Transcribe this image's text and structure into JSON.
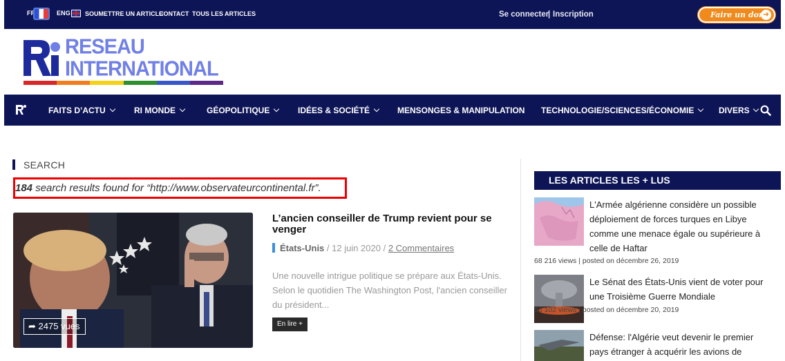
{
  "topbar": {
    "lang_fr": "FR",
    "lang_en": "ENG",
    "links": [
      "SOUMETTRE UN ARTICLE",
      "CONTACT",
      "TOUS LES ARTICLES"
    ],
    "login": "Se connecter",
    "separator": "|",
    "register": "Inscription",
    "donate": "Faire un don"
  },
  "logo": {
    "line1": "RESEAU",
    "line2": "INTERNATIONAL"
  },
  "nav": {
    "items": [
      "FAITS D’ACTU",
      "RI MONDE",
      "GÉOPOLITIQUE",
      "IDÉES & SOCIÉTÉ",
      "MENSONGES & MANIPULATION",
      "TECHNOLOGIE/SCIENCES/ÉCONOMIE",
      "DIVERS"
    ]
  },
  "search": {
    "label": "SEARCH",
    "count": "184",
    "results_text": " search results found for “http://www.observateurcontinental.fr”."
  },
  "article": {
    "views": "2475 vues",
    "title": "L’ancien conseiller de Trump revient pour se venger",
    "category": "États-Unis",
    "date": " / 12 juin 2020 / ",
    "comments": "2 Commentaires",
    "excerpt": "Une nouvelle intrigue politique se prépare aux États-Unis. Selon le quotidien The Washington Post, l'ancien conseiller du président...",
    "read_more": "En lire +"
  },
  "sidebar": {
    "heading": "LES ARTICLES LES + LUS",
    "items": [
      {
        "title": "L'Armée algérienne considère un possible déploiement de forces turques en Libye comme une menace égale ou supérieure à celle de Haftar",
        "meta": "68 216 views | posted on décembre 26, 2019"
      },
      {
        "title": "Le Sénat des États-Unis vient de voter pour une Troisième Guerre Mondiale",
        "meta": "56 102 views | posted on décembre 20, 2019"
      },
      {
        "title": "Défense: l'Algérie veut devenir le premier pays étranger à acquérir les avions de combat furtifs",
        "meta": ""
      }
    ]
  },
  "colors": {
    "navy": "#0e1556",
    "accent_orange": "#f08a1c",
    "highlight_red": "#ee0000",
    "category_blue": "#3a8fdb"
  }
}
